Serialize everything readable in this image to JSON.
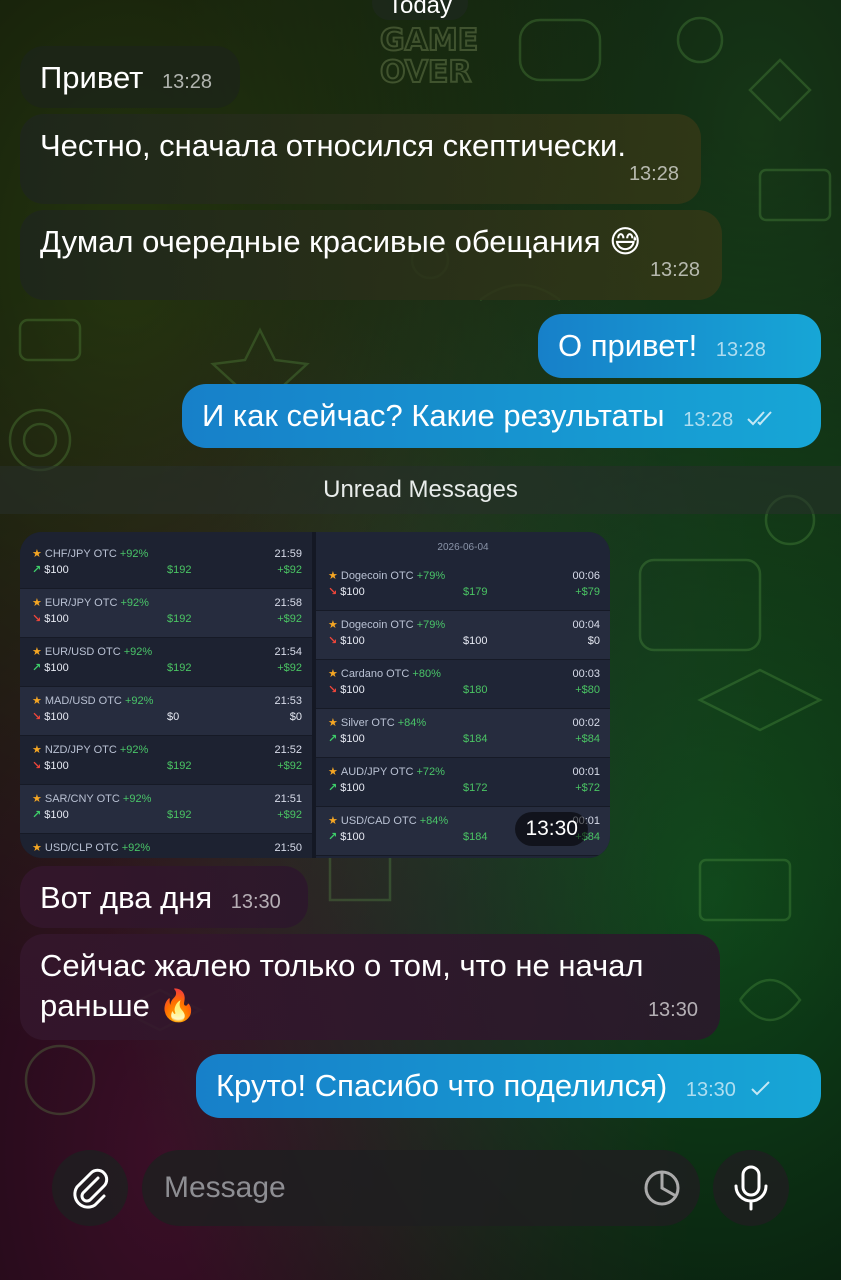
{
  "date_pill": "Today",
  "messages": [
    {
      "text": "Привет",
      "time": "13:28"
    },
    {
      "text": "Честно, сначала относился скептически.",
      "time": "13:28"
    },
    {
      "text": "Думал очередные красивые обещания 😅",
      "time": "13:28"
    },
    {
      "text": "О привет!",
      "time": "13:28"
    },
    {
      "text": "И как сейчас? Какие результаты",
      "time": "13:28"
    },
    {
      "text": "Вот два дня",
      "time": "13:30"
    },
    {
      "text": "Сейчас жалею только о том, что не начал раньше 🔥",
      "time": "13:30"
    },
    {
      "text": "Круто! Спасибо что поделился)",
      "time": "13:30"
    }
  ],
  "unread_label": "Unread Messages",
  "photo": {
    "time": "13:30",
    "right_date": "2026-06-04",
    "left_trades": [
      {
        "pair": "CHF/JPY OTC",
        "pct": "+92%",
        "time": "21:59",
        "dir": "up",
        "amount": "$100",
        "payout": "$192",
        "profit": "+$92"
      },
      {
        "pair": "EUR/JPY OTC",
        "pct": "+92%",
        "time": "21:58",
        "dir": "down",
        "amount": "$100",
        "payout": "$192",
        "profit": "+$92"
      },
      {
        "pair": "EUR/USD OTC",
        "pct": "+92%",
        "time": "21:54",
        "dir": "up",
        "amount": "$100",
        "payout": "$192",
        "profit": "+$92"
      },
      {
        "pair": "MAD/USD OTC",
        "pct": "+92%",
        "time": "21:53",
        "dir": "down",
        "amount": "$100",
        "payout": "$0",
        "profit": "$0"
      },
      {
        "pair": "NZD/JPY OTC",
        "pct": "+92%",
        "time": "21:52",
        "dir": "down",
        "amount": "$100",
        "payout": "$192",
        "profit": "+$92"
      },
      {
        "pair": "SAR/CNY OTC",
        "pct": "+92%",
        "time": "21:51",
        "dir": "up",
        "amount": "$100",
        "payout": "$192",
        "profit": "+$92"
      },
      {
        "pair": "USD/CLP OTC",
        "pct": "+92%",
        "time": "21:50",
        "dir": "up",
        "amount": "",
        "payout": "",
        "profit": ""
      }
    ],
    "right_trades": [
      {
        "pair": "Dogecoin OTC",
        "pct": "+79%",
        "time": "00:06",
        "dir": "down",
        "amount": "$100",
        "payout": "$179",
        "profit": "+$79"
      },
      {
        "pair": "Dogecoin OTC",
        "pct": "+79%",
        "time": "00:04",
        "dir": "down",
        "amount": "$100",
        "payout": "$100",
        "profit": "$0"
      },
      {
        "pair": "Cardano OTC",
        "pct": "+80%",
        "time": "00:03",
        "dir": "down",
        "amount": "$100",
        "payout": "$180",
        "profit": "+$80"
      },
      {
        "pair": "Silver OTC",
        "pct": "+84%",
        "time": "00:02",
        "dir": "up",
        "amount": "$100",
        "payout": "$184",
        "profit": "+$84"
      },
      {
        "pair": "AUD/JPY OTC",
        "pct": "+72%",
        "time": "00:01",
        "dir": "up",
        "amount": "$100",
        "payout": "$172",
        "profit": "+$72"
      },
      {
        "pair": "USD/CAD OTC",
        "pct": "+84%",
        "time": "00:01",
        "dir": "up",
        "amount": "$100",
        "payout": "$184",
        "profit": "+$84"
      }
    ]
  },
  "composer": {
    "placeholder": "Message",
    "attach_icon": "paperclip-icon",
    "sticker_icon": "sticker-icon",
    "mic_icon": "microphone-icon"
  },
  "colors": {
    "outgoing_bubble": "#1a95d0",
    "incoming_bubble": "#1e261c",
    "profit_green": "#4ac463",
    "loss_red": "#f0463a"
  }
}
